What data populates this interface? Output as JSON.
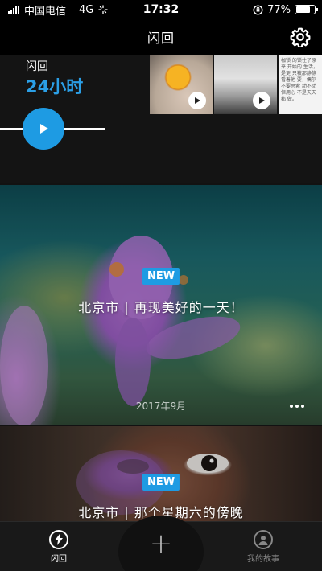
{
  "status_bar": {
    "carrier": "中国电信",
    "network": "4G",
    "time": "17:32",
    "battery": "77%",
    "battery_level": 0.77
  },
  "nav": {
    "title": "闪回",
    "settings_icon": "gear-icon"
  },
  "flashback": {
    "label": "闪回",
    "period": "24小时",
    "play_icon": "play-icon",
    "thumbnails": [
      {
        "name": "egg-yolk",
        "play_icon": "play-icon"
      },
      {
        "name": "laptop",
        "play_icon": "play-icon"
      },
      {
        "name": "text-note",
        "text": "枷锁 的锁住了原来 开始的 生活，是更 只被那静静看着他 要，偶尔不要思索 动不动 但用心 不是天天都 做。"
      }
    ]
  },
  "stories": [
    {
      "badge": "NEW",
      "title": "北京市 | 再现美好的一天！",
      "date": "2017年9月",
      "more_icon": "more-icon"
    },
    {
      "badge": "NEW",
      "title": "北京市 | 那个星期六的傍晚"
    }
  ],
  "tab_bar": {
    "tabs": [
      {
        "label": "闪回",
        "icon": "flash-icon",
        "active": true
      },
      {
        "label": "我的故事",
        "icon": "user-icon",
        "active": false
      }
    ],
    "add_label": "+"
  },
  "colors": {
    "accent": "#1e9be3",
    "hours_text": "#2b9fe6",
    "background": "#121212"
  }
}
